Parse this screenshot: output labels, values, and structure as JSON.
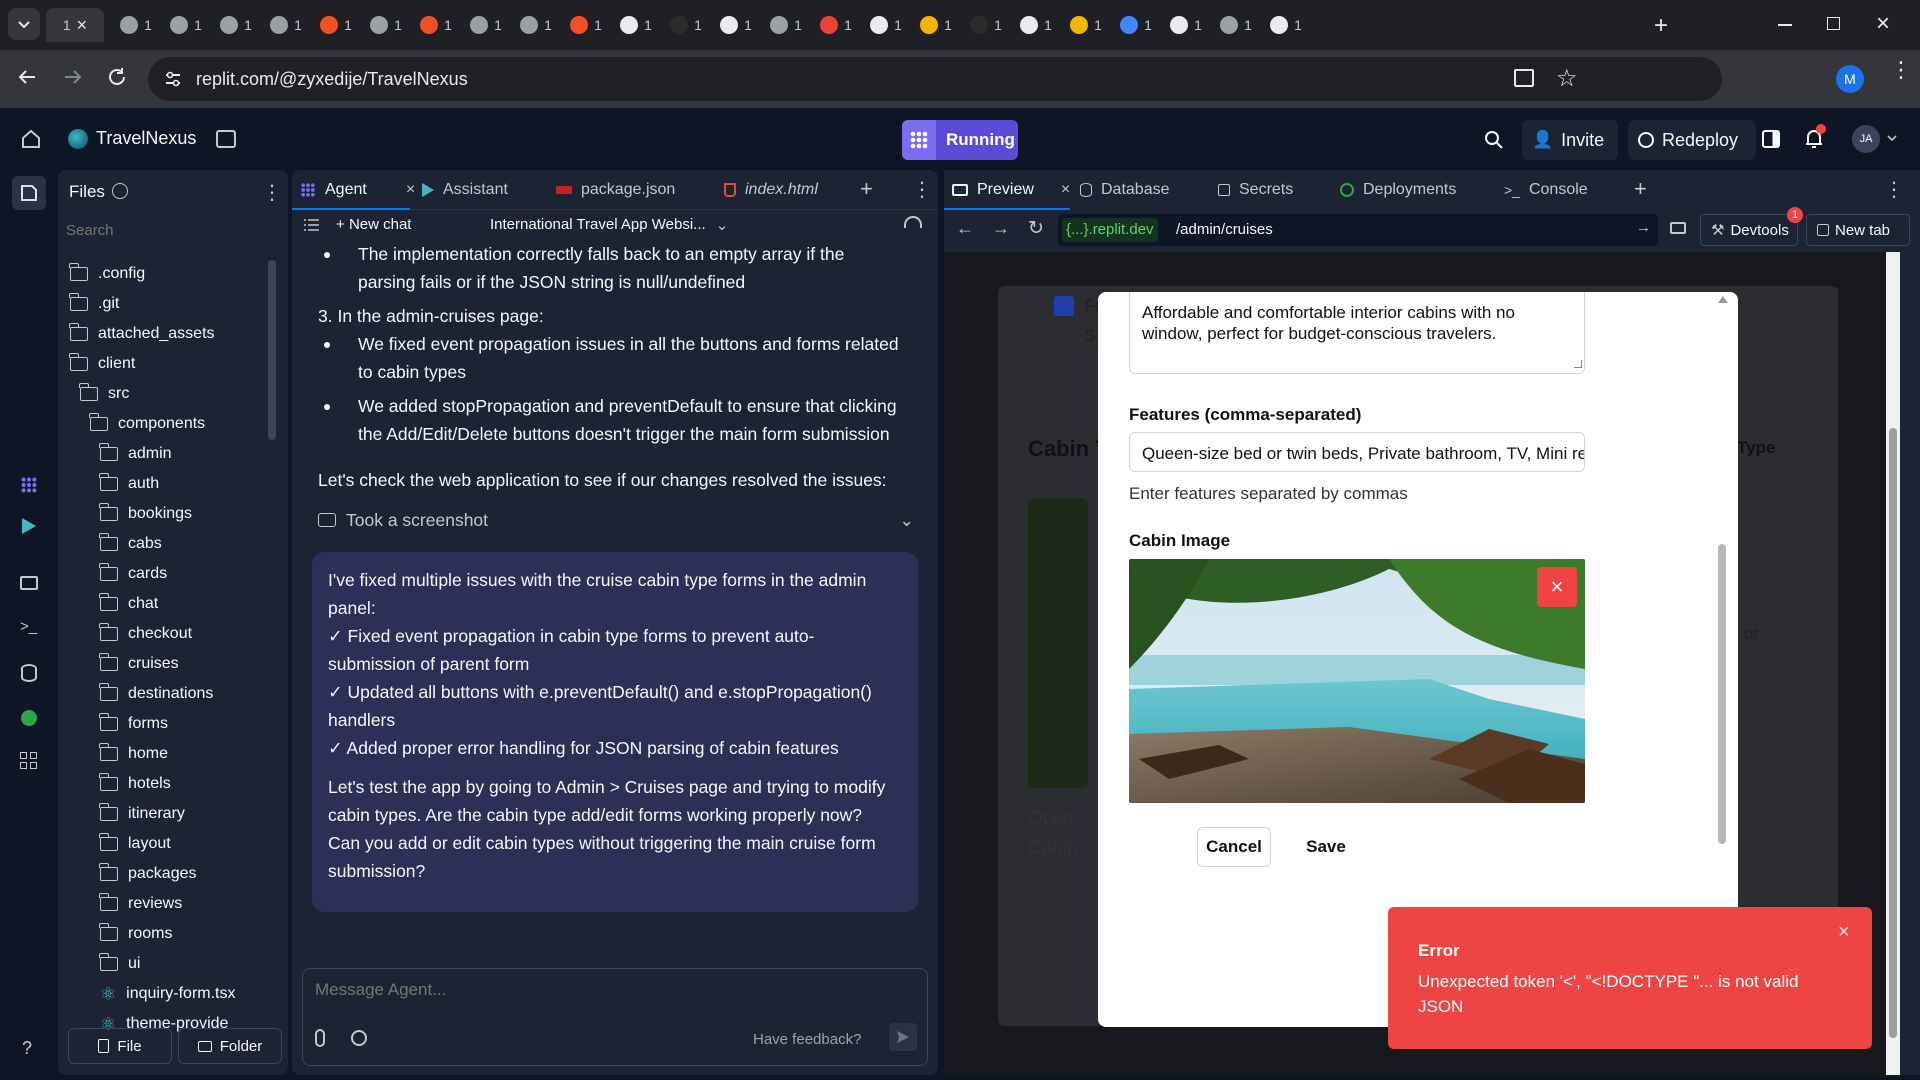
{
  "browser": {
    "tabs": [
      "1",
      "1",
      "1",
      "1",
      "1",
      "1",
      "1",
      "1",
      "1",
      "1",
      "1",
      "1",
      "1",
      "1",
      "1",
      "1",
      "1",
      "1",
      "1",
      "1",
      "1",
      "1",
      "1",
      "1",
      "1",
      "1"
    ],
    "active_tab_label": "1",
    "url": "replit.com/@zyxedije/TravelNexus",
    "profile_initial": "M"
  },
  "header": {
    "project_name": "TravelNexus",
    "run_label": "Running",
    "invite_label": "Invite",
    "redeploy_label": "Redeploy",
    "avatar_initials": "JA"
  },
  "files": {
    "title": "Files",
    "search_placeholder": "Search",
    "items": [
      ".config",
      ".git",
      "attached_assets",
      "client",
      "src",
      "components",
      "admin",
      "auth",
      "bookings",
      "cabs",
      "cards",
      "chat",
      "checkout",
      "cruises",
      "destinations",
      "forms",
      "home",
      "hotels",
      "itinerary",
      "layout",
      "packages",
      "reviews",
      "rooms",
      "ui",
      "inquiry-form.tsx",
      "theme-provide"
    ],
    "file_button": "File",
    "folder_button": "Folder"
  },
  "agent": {
    "tabs": [
      "Agent",
      "Assistant",
      "package.json",
      "index.html"
    ],
    "new_chat": "New chat",
    "chat_title": "International Travel App Websi...",
    "lines": [
      "The implementation correctly falls back to an empty array if the",
      "parsing fails or if the JSON string is null/undefined",
      "3. In the admin-cruises page:",
      "We fixed event propagation issues in all the buttons and forms related",
      "to cabin types",
      "We added stopPropagation and preventDefault to ensure that clicking",
      "the Add/Edit/Delete buttons doesn't trigger the main form submission",
      "Let's check the web application to see if our changes resolved the issues:"
    ],
    "screenshot_label": "Took a screenshot",
    "bubble_lines": [
      "I've fixed multiple issues with the cruise cabin type forms in the admin",
      "panel:",
      "✓ Fixed event propagation in cabin type forms to prevent auto-",
      "submission of parent form",
      "✓ Updated all buttons with e.preventDefault() and e.stopPropagation()",
      "handlers",
      "✓ Added proper error handling for JSON parsing of cabin features",
      "Let's test the app by going to Admin > Cruises page and trying to modify",
      "cabin types. Are the cabin type add/edit forms working properly now?",
      "Can you add or edit cabin types without triggering the main cruise form",
      "submission?"
    ],
    "message_placeholder": "Message Agent...",
    "feedback": "Have feedback?"
  },
  "preview": {
    "tabs": [
      "Preview",
      "Database",
      "Secrets",
      "Deployments",
      "Console"
    ],
    "domain": "{...}.replit.dev",
    "path": "/admin/cruises",
    "devtools": "Devtools",
    "devtools_badge": "1",
    "new_tab": "New tab",
    "bg_heading": "Cabin T",
    "bg_type": "Type",
    "bg_checkbox_label": "Fe",
    "bg_small": "S",
    "bg_or": "or",
    "bg_img_alt": "Ocea",
    "bg_img_alt2": "Cabin"
  },
  "modal": {
    "description": "Affordable and comfortable interior cabins with no window, perfect for budget-conscious travelers.",
    "features_label": "Features (comma-separated)",
    "features_value": "Queen-size bed or twin beds, Private bathroom, TV, Mini refrigerator",
    "features_help": "Enter features separated by commas",
    "image_label": "Cabin Image",
    "cancel": "Cancel",
    "save": "Save"
  },
  "toast": {
    "title": "Error",
    "message": "Unexpected token '<', \"<!DOCTYPE \"... is not valid JSON"
  },
  "colors": {
    "accent": "#5b4bd6",
    "error": "#ef4444",
    "bubble": "#2d2f57",
    "panel": "#1c2333"
  }
}
